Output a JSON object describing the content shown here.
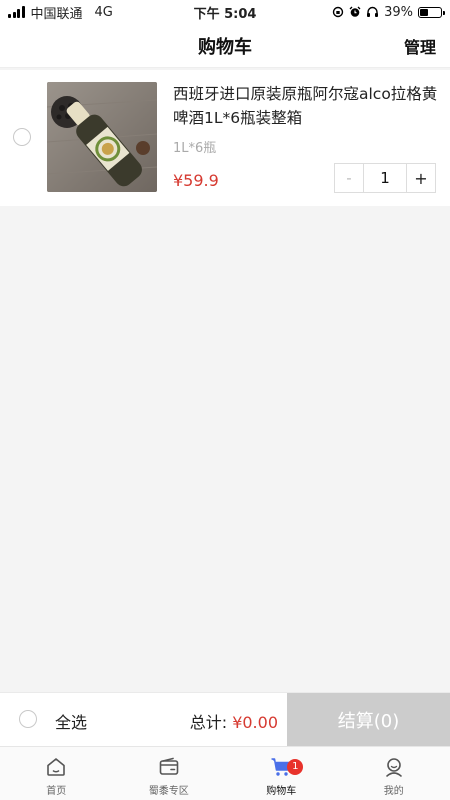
{
  "status_bar": {
    "carrier": "中国联通",
    "network": "4G",
    "time": "下午 5:04",
    "battery": "39%",
    "battery_level": 0.39
  },
  "nav": {
    "title": "购物车",
    "manage_label": "管理"
  },
  "cart": {
    "items": [
      {
        "title": "西班牙进口原装原瓶阿尔寇alco拉格黄啤酒1L*6瓶装整箱",
        "spec": "1L*6瓶",
        "price": "¥59.9",
        "quantity": "1",
        "minus_label": "-",
        "plus_label": "+",
        "image_icon": "beer-bottle-image"
      }
    ]
  },
  "checkout": {
    "select_all_label": "全选",
    "total_label": "总计: ",
    "total_amount": "¥0.00",
    "button_label": "结算(0)"
  },
  "tabs": [
    {
      "label": "首页",
      "icon": "home-icon"
    },
    {
      "label": "蜀黍专区",
      "icon": "wallet-icon"
    },
    {
      "label": "购物车",
      "icon": "cart-icon",
      "badge": "1",
      "active": true
    },
    {
      "label": "我的",
      "icon": "profile-icon"
    }
  ],
  "colors": {
    "price_red": "#d63a31",
    "accent_blue": "#4a6fe8",
    "badge_red": "#e8322b",
    "checkout_disabled": "#cccccc"
  }
}
